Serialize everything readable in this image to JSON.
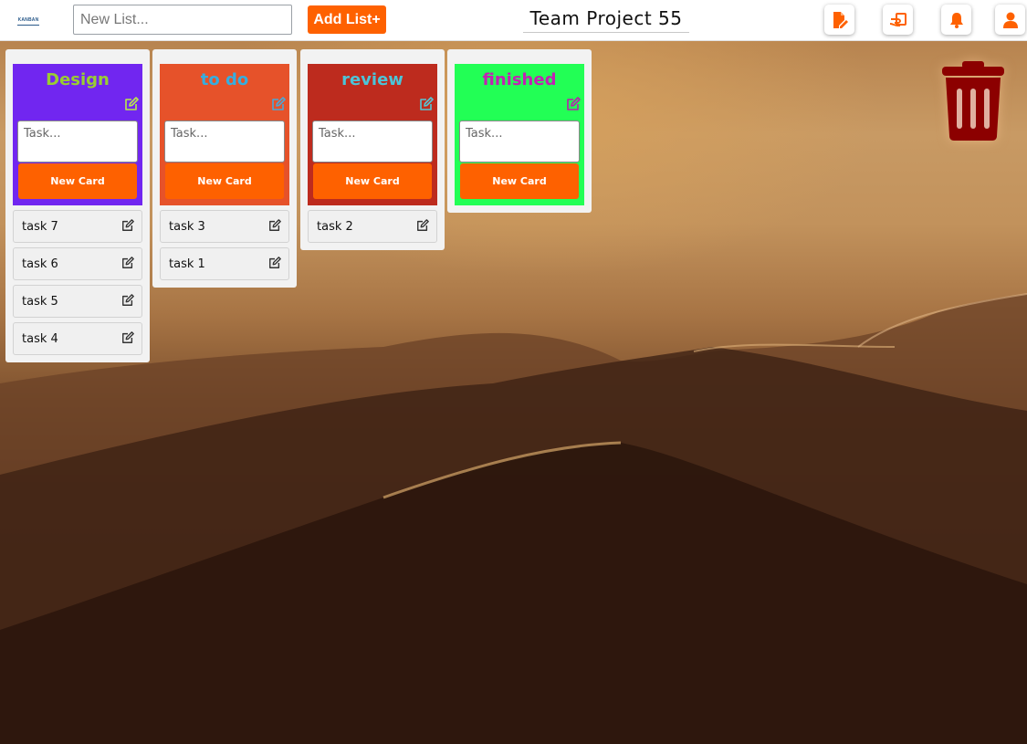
{
  "app": {
    "logo_text": "KANBAN"
  },
  "header": {
    "new_list_placeholder": "New List...",
    "add_list_label": "Add List+",
    "project_title": "Team Project 55",
    "icons": [
      "edit-document-icon",
      "hand-card-icon",
      "bell-icon",
      "user-icon"
    ],
    "accent": "#fe6100"
  },
  "lists": [
    {
      "title": "Design",
      "title_color": "#9acd32",
      "bg_color": "#7126f0",
      "icon_color": "#b9e94a",
      "task_placeholder": "Task...",
      "new_card_label": "New Card",
      "cards": [
        "task 7",
        "task 6",
        "task 5",
        "task 4"
      ]
    },
    {
      "title": "to do",
      "title_color": "#35aee0",
      "bg_color": "#e6522a",
      "icon_color": "#4aa8d8",
      "task_placeholder": "Task...",
      "new_card_label": "New Card",
      "cards": [
        "task 3",
        "task 1"
      ]
    },
    {
      "title": "review",
      "title_color": "#4cc4d8",
      "bg_color": "#bd2b1e",
      "icon_color": "#56c6d6",
      "task_placeholder": "Task...",
      "new_card_label": "New Card",
      "cards": [
        "task 2"
      ]
    },
    {
      "title": "finished",
      "title_color": "#c222b4",
      "bg_color": "#22ff55",
      "icon_color": "#b81fab",
      "task_placeholder": "Task...",
      "new_card_label": "New Card",
      "cards": []
    }
  ],
  "trash": {
    "icon": "trash-icon",
    "color": "#8c0000"
  }
}
